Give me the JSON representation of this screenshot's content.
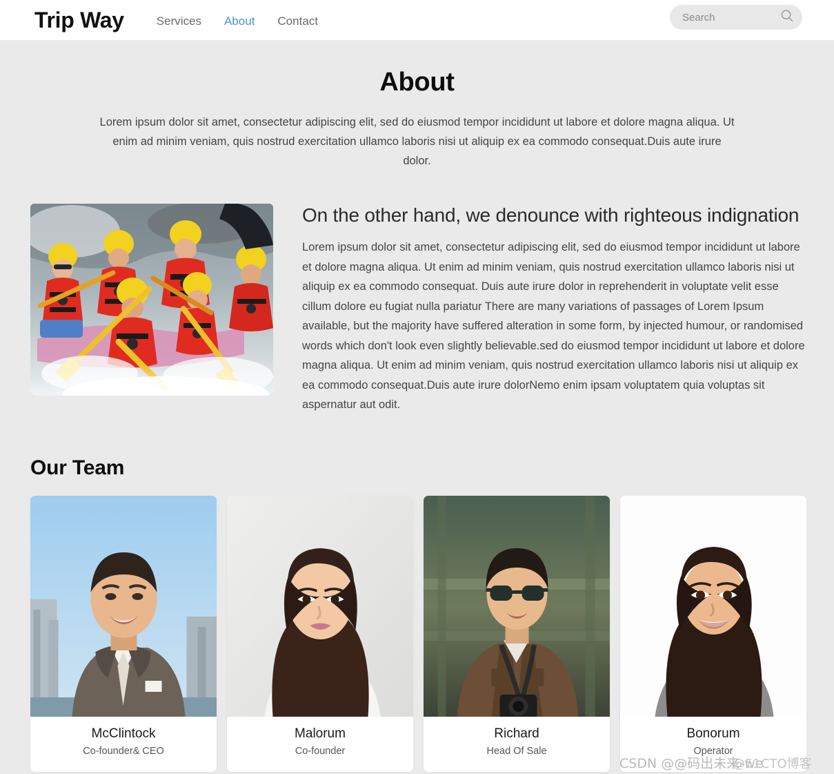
{
  "header": {
    "brand": "Trip Way",
    "nav": [
      {
        "label": "Services",
        "active": false
      },
      {
        "label": "About",
        "active": true
      },
      {
        "label": "Contact",
        "active": false
      }
    ],
    "search": {
      "placeholder": "Search",
      "value": "",
      "icon": "search-icon"
    },
    "accent_color": "#4a90d9",
    "background": "#ffffff"
  },
  "hero": {
    "title": "About",
    "paragraph": "Lorem ipsum dolor sit amet, consectetur adipiscing elit, sed do eiusmod tempor incididunt ut labore et dolore magna aliqua. Ut enim ad minim veniam, quis nostrud exercitation ullamco laboris nisi ut aliquip ex ea commodo consequat.Duis aute irure dolor."
  },
  "content": {
    "image_alt": "whitewater-rafting-team-photo",
    "heading": "On the other hand, we denounce with righteous indignation",
    "paragraph": "Lorem ipsum dolor sit amet, consectetur adipiscing elit, sed do eiusmod tempor incididunt ut labore et dolore magna aliqua. Ut enim ad minim veniam, quis nostrud exercitation ullamco laboris nisi ut aliquip ex ea commodo consequat. Duis aute irure dolor in reprehenderit in voluptate velit esse cillum dolore eu fugiat nulla pariatur There are many variations of passages of Lorem Ipsum available, but the majority have suffered alteration in some form, by injected humour, or randomised words which don't look even slightly believable.sed do eiusmod tempor incididunt ut labore et dolore magna aliqua. Ut enim ad minim veniam, quis nostrud exercitation ullamco laboris nisi ut aliquip ex ea commodo consequat.Duis aute irure dolorNemo enim ipsam voluptatem quia voluptas sit aspernatur aut odit."
  },
  "team": {
    "title": "Our Team",
    "members": [
      {
        "name": "McClintock",
        "role": "Co-founder& CEO",
        "photo": "man-in-suit-city-background"
      },
      {
        "name": "Malorum",
        "role": "Co-founder",
        "photo": "woman-long-dark-hair-white-background"
      },
      {
        "name": "Richard",
        "role": "Head Of Sale",
        "photo": "man-with-sunglasses-and-camera"
      },
      {
        "name": "Bonorum",
        "role": "Operator",
        "photo": "woman-smiling-grey-top"
      }
    ]
  },
  "watermark": {
    "primary": "CSDN @@码出未来-we",
    "secondary": "@51CTO博客"
  },
  "page": {
    "background": "#eaeaea",
    "card_background": "#ffffff"
  }
}
